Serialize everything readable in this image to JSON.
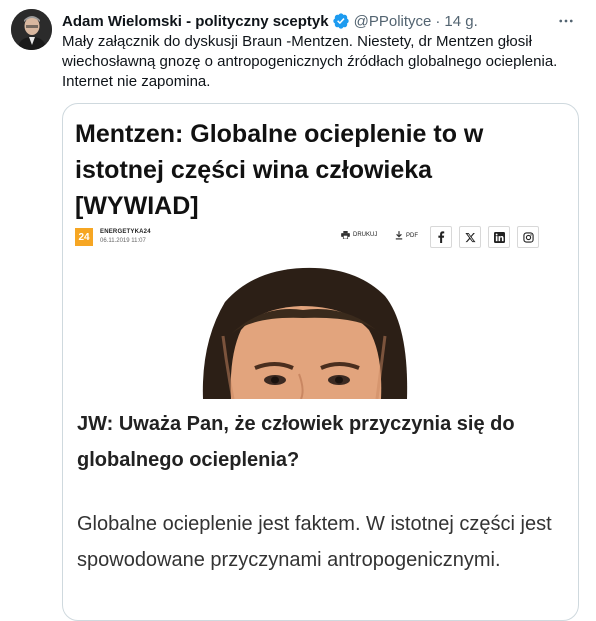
{
  "tweet": {
    "author_name": "Adam Wielomski - polityczny sceptyk",
    "handle": "@PPolityce",
    "separator": "·",
    "time": "14 g.",
    "text": "Mały załącznik do dyskusji Braun -Mentzen. Niestety, dr Mentzen głosił wiechosławną gnozę o antropogenicznych źródłach globalnego ocieplenia. Internet nie zapomina."
  },
  "card": {
    "title": "Mentzen: Globalne ocieplenie to w istotnej części wina człowieka [WYWIAD]",
    "source": {
      "logo_text": "24",
      "name": "ENERGETYKA24",
      "date": "06.11.2019 11:07"
    },
    "tools": {
      "print_label": "DRUKUJ",
      "pdf_label": "PDF"
    },
    "share_icons": [
      "facebook-icon",
      "x-icon",
      "linkedin-icon",
      "instagram-icon"
    ],
    "question": "JW: Uważa Pan, że człowiek przyczynia się do globalnego ocieplenia?",
    "answer": "Globalne ocieplenie jest faktem. W istotnej części jest spowodowane przyczynami antropogenicznymi."
  },
  "colors": {
    "verified_blue": "#1d9bf0",
    "secondary_text": "#536471",
    "logo_orange": "#f6a623",
    "card_border": "#cfd9de"
  }
}
